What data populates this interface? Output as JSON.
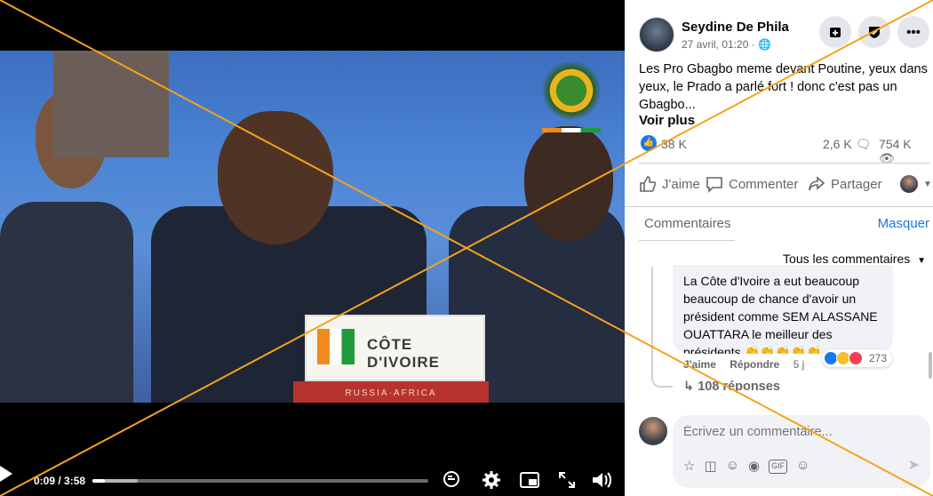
{
  "video": {
    "nameplate_country": "CÔTE D'IVOIRE",
    "nameplate_base": "RUSSIA·AFRICA",
    "time_display": "0:09 / 3:58",
    "progress_fraction": 0.038,
    "buffer_fraction": 0.135
  },
  "post": {
    "author": "Seydine De Phila",
    "date": "27 avril, 01:20 · ",
    "text": "Les Pro Gbagbo meme devant Poutine, yeux dans yeux, le Prado a parlé fort ! donc c'est pas un Gbagbo...",
    "see_more": "Voir plus",
    "reaction_count": "38 K",
    "comment_count": "2,6 K",
    "view_count": "754 K",
    "actions": {
      "like": "J'aime",
      "comment": "Commenter",
      "share": "Partager"
    }
  },
  "comments": {
    "tab_label": "Commentaires",
    "hide_label": "Masquer",
    "filter_label": "Tous les commentaires",
    "top_comment": {
      "text": "La Côte d'Ivoire a eut beaucoup beaucoup de chance d'avoir un président comme SEM ALASSANE OUATTARA le meilleur des présidents 👏👏👏👏👏.",
      "like_action": "J'aime",
      "reply_action": "Répondre",
      "age": "5 j",
      "reaction_count": "273"
    },
    "replies_label": "108 réponses",
    "composer_placeholder": "Écrivez un commentaire..."
  },
  "colors": {
    "accent": "#1877f2",
    "cross_line": "#f7a21b"
  }
}
